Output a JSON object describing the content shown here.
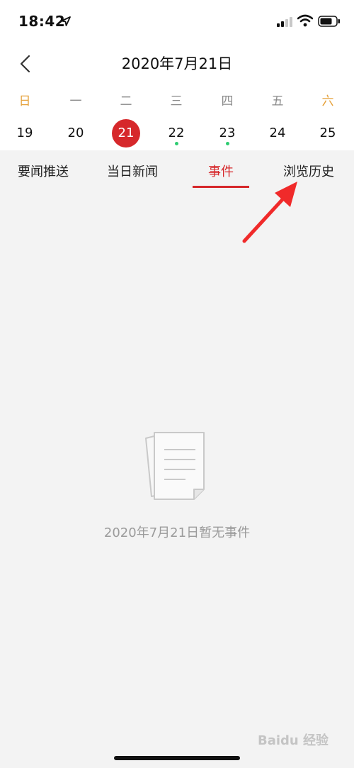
{
  "status_bar": {
    "time": "18:42",
    "icons": [
      "location-arrow-icon",
      "cellular-signal-icon",
      "wifi-icon",
      "battery-icon"
    ]
  },
  "header": {
    "back_icon": "chevron-left-icon",
    "title": "2020年7月21日"
  },
  "calendar": {
    "weekdays": [
      "日",
      "一",
      "二",
      "三",
      "四",
      "五",
      "六"
    ],
    "dates": [
      "19",
      "20",
      "21",
      "22",
      "23",
      "24",
      "25"
    ],
    "selected_date": "21",
    "event_dot_dates": [
      "22",
      "23"
    ],
    "weekend_color": "#e6a23c",
    "selected_color": "#d6282b",
    "dot_color": "#2ecc71"
  },
  "tabs": {
    "items": [
      "要闻推送",
      "当日新闻",
      "事件",
      "浏览历史"
    ],
    "active": "事件",
    "active_color": "#d6282b"
  },
  "empty_state": {
    "icon": "document-icon",
    "message": "2020年7月21日暂无事件"
  },
  "annotation": {
    "icon": "red-arrow-icon",
    "color": "#f02a2a"
  },
  "watermark": {
    "text": "Baidu 经验"
  }
}
